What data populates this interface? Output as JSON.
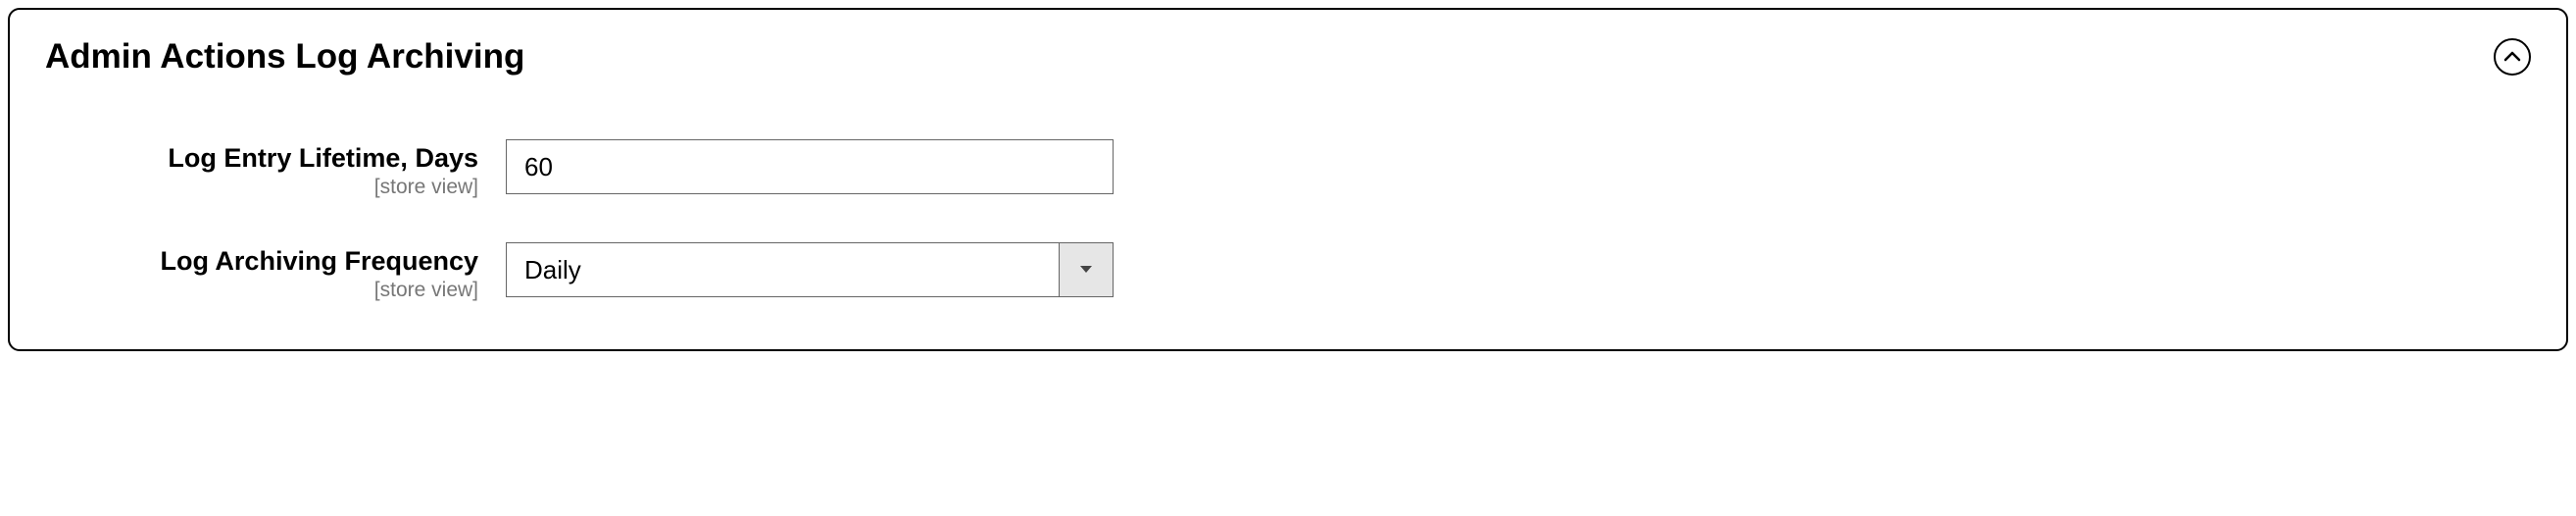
{
  "panel": {
    "title": "Admin Actions Log Archiving"
  },
  "fields": {
    "lifetime": {
      "label": "Log Entry Lifetime, Days",
      "scope": "[store view]",
      "value": "60"
    },
    "frequency": {
      "label": "Log Archiving Frequency",
      "scope": "[store view]",
      "value": "Daily"
    }
  }
}
